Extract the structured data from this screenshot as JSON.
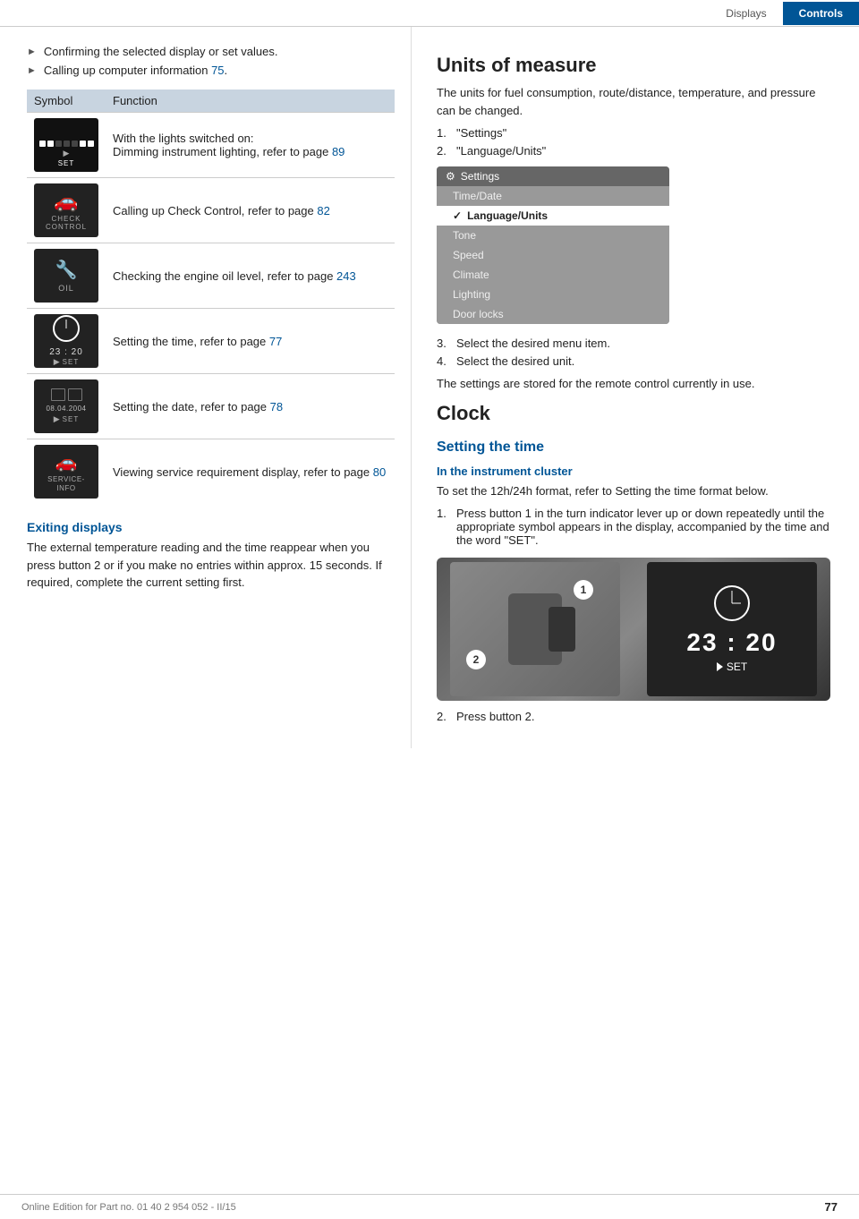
{
  "header": {
    "tab_displays": "Displays",
    "tab_controls": "Controls"
  },
  "left": {
    "bullet1": "Confirming the selected display or set values.",
    "bullet2": "Calling up computer information",
    "bullet2_link": "75",
    "bullet2_link_suffix": ".",
    "table": {
      "col1": "Symbol",
      "col2": "Function",
      "rows": [
        {
          "sym_type": "settings",
          "func_line1": "With the lights switched on:",
          "func_line2": "Dimming instrument lighting, refer to page",
          "func_link": "89",
          "func_link_label": "89"
        },
        {
          "sym_type": "check_control",
          "func_line1": "Calling up Check Control, refer to page",
          "func_link": "82",
          "func_link_label": "82"
        },
        {
          "sym_type": "oil",
          "func_line1": "Checking the engine oil level, refer to page",
          "func_link": "243",
          "func_link_label": "243"
        },
        {
          "sym_type": "clock",
          "func_line1": "Setting the time, refer to page",
          "func_link": "77",
          "func_link_label": "77"
        },
        {
          "sym_type": "date",
          "func_line1": "Setting the date, refer to page",
          "func_link": "78",
          "func_link_label": "78"
        },
        {
          "sym_type": "service",
          "func_line1": "Viewing service requirement display, refer to page",
          "func_link": "80",
          "func_link_label": "80"
        }
      ]
    },
    "exiting_heading": "Exiting displays",
    "exiting_para": "The external temperature reading and the time reappear when you press button 2 or if you make no entries within approx. 15 seconds. If required, complete the current setting first."
  },
  "right": {
    "units_heading": "Units of measure",
    "units_para": "The units for fuel consumption, route/distance, temperature, and pressure can be changed.",
    "units_steps": [
      {
        "num": "1.",
        "text": "\"Settings\""
      },
      {
        "num": "2.",
        "text": "\"Language/Units\""
      }
    ],
    "settings_screenshot": {
      "title": "Settings",
      "items": [
        {
          "label": "Time/Date",
          "type": "normal"
        },
        {
          "label": "Language/Units",
          "type": "selected"
        },
        {
          "label": "Tone",
          "type": "normal"
        },
        {
          "label": "Speed",
          "type": "normal"
        },
        {
          "label": "Climate",
          "type": "normal"
        },
        {
          "label": "Lighting",
          "type": "normal"
        },
        {
          "label": "Door locks",
          "type": "normal"
        }
      ]
    },
    "units_step3": "Select the desired menu item.",
    "units_step4": "Select the desired unit.",
    "units_footer": "The settings are stored for the remote control currently in use.",
    "clock_heading": "Clock",
    "setting_time_heading": "Setting the time",
    "instrument_cluster_heading": "In the instrument cluster",
    "instrument_para": "To set the 12h/24h format, refer to Setting the time format below.",
    "clock_steps": [
      {
        "num": "1.",
        "text": "Press button 1 in the turn indicator lever up or down repeatedly until the appropriate symbol appears in the display, accompanied by the time and the word \"SET\"."
      },
      {
        "num": "2.",
        "text": "Press button 2."
      }
    ],
    "cluster_time": "23 : 20",
    "cluster_set": "SET",
    "num_badge_1": "1",
    "num_badge_2": "2"
  },
  "footer": {
    "text": "Online Edition for Part no. 01 40 2 954 052 - II/15",
    "page": "77"
  }
}
